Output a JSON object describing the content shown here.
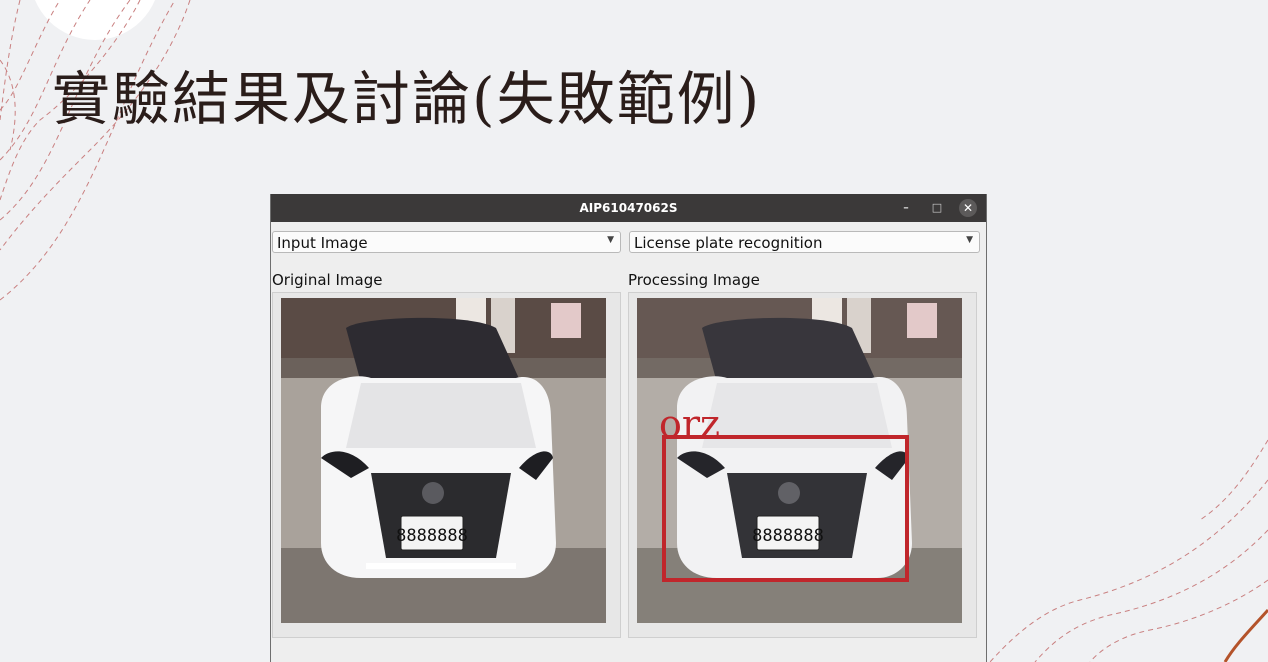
{
  "slide": {
    "title": "實驗結果及討論(失敗範例)"
  },
  "window": {
    "title": "AIP61047062S",
    "controls": {
      "minimize": "–",
      "maximize": "□",
      "close": "✕"
    }
  },
  "toolbar": {
    "input_select": {
      "value": "Input Image"
    },
    "mode_select": {
      "value": "License plate recognition"
    }
  },
  "panels": {
    "original": {
      "label": "Original Image",
      "plate_text": "8888888"
    },
    "processing": {
      "label": "Processing Image",
      "plate_text": "8888888",
      "detection_label": "orz"
    }
  },
  "colors": {
    "accent": "#c0262b",
    "titlebar": "#3b3939",
    "background": "#f0f1f3"
  }
}
